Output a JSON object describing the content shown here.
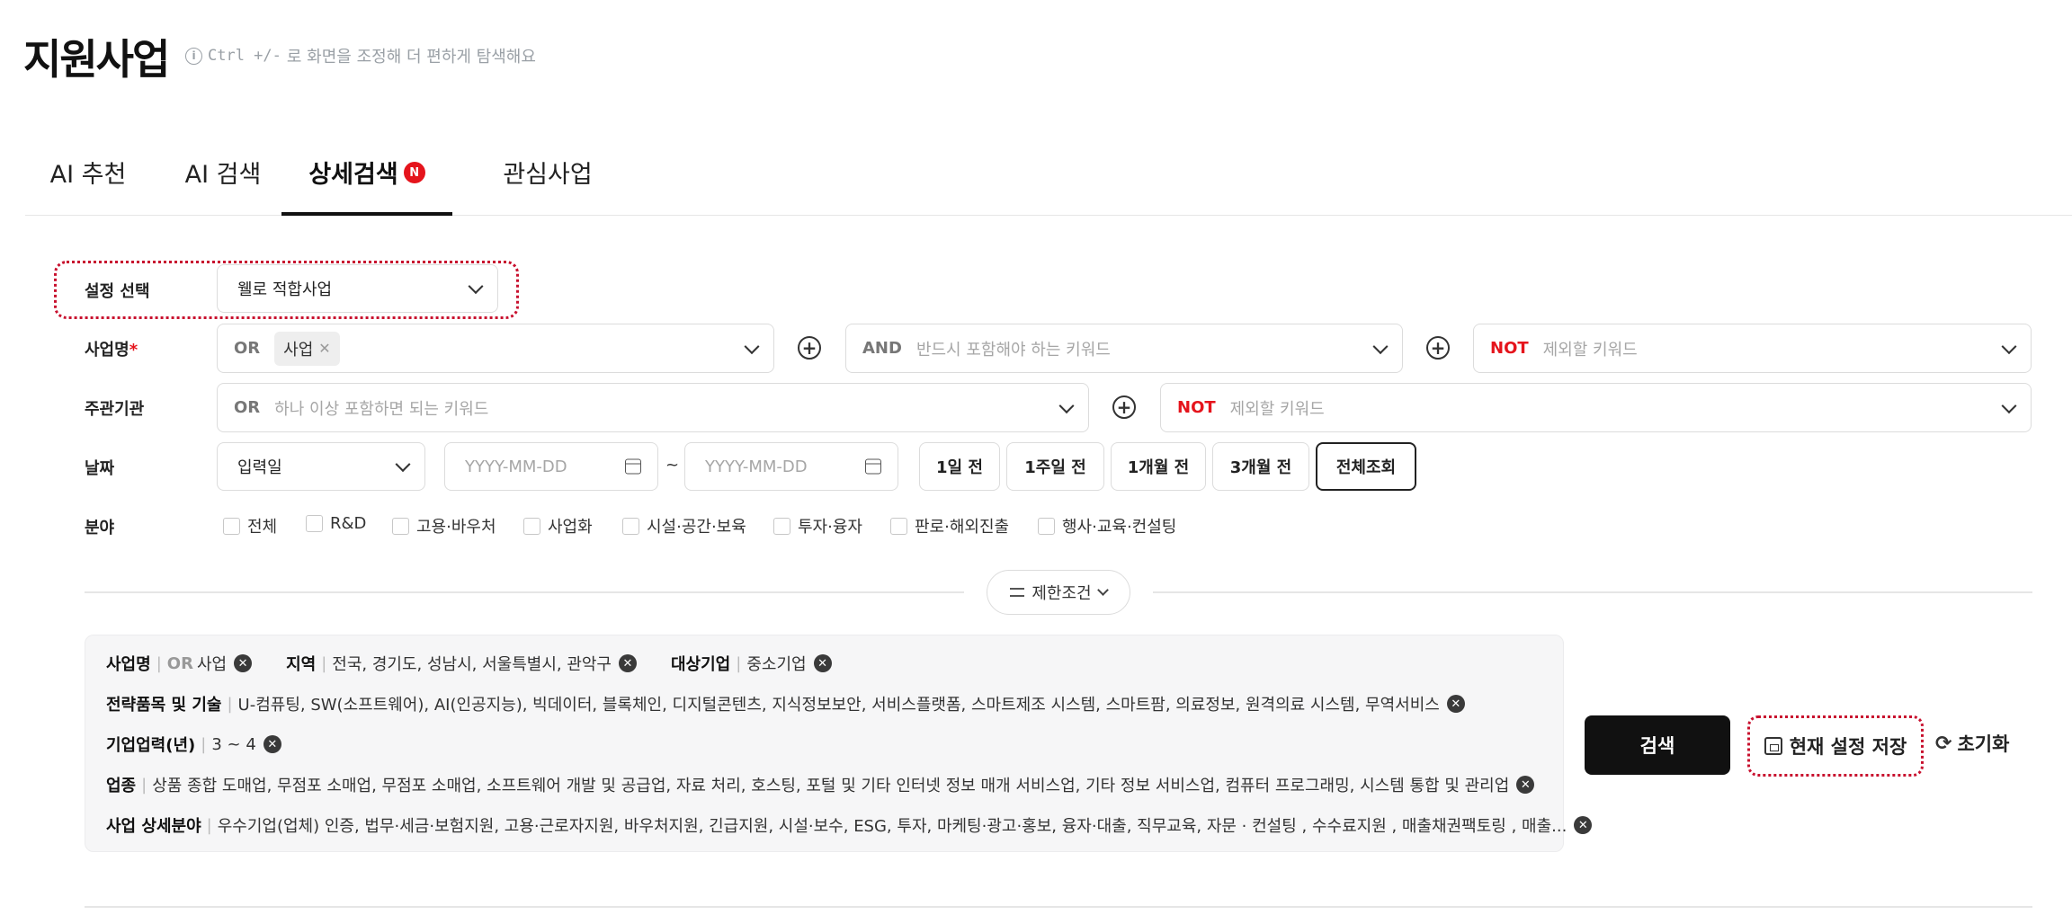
{
  "page": {
    "title": "지원사업",
    "hint_prefix": "Ctrl +/-",
    "hint_text": "로 화면을 조정해 더 편하게 탐색해요"
  },
  "tabs": [
    {
      "label": "AI 추천"
    },
    {
      "label": "AI 검색"
    },
    {
      "label": "상세검색",
      "badge": "N",
      "active": true
    },
    {
      "label": "관심사업"
    }
  ],
  "form": {
    "setting": {
      "label": "설정 선택",
      "value": "웰로 적합사업"
    },
    "business_name": {
      "label": "사업명",
      "required_mark": "*",
      "or_op": "OR",
      "chip": "사업",
      "and_op": "AND",
      "and_placeholder": "반드시 포함해야 하는 키워드",
      "not_op": "NOT",
      "not_placeholder": "제외할 키워드"
    },
    "organizer": {
      "label": "주관기관",
      "or_op": "OR",
      "or_placeholder": "하나 이상 포함하면 되는 키워드",
      "not_op": "NOT",
      "not_placeholder": "제외할 키워드"
    },
    "date": {
      "label": "날짜",
      "type_value": "입력일",
      "start_placeholder": "YYYY-MM-DD",
      "tilde": "~",
      "end_placeholder": "YYYY-MM-DD",
      "presets": [
        "1일 전",
        "1주일 전",
        "1개월 전",
        "3개월 전",
        "전체조회"
      ],
      "selected_preset": "전체조회"
    },
    "field": {
      "label": "분야",
      "options": [
        "전체",
        "R&D",
        "고용·바우처",
        "사업화",
        "시설·공간·보육",
        "투자·융자",
        "판로·해외진출",
        "행사·교육·컨설팅"
      ]
    },
    "limit_button": "제한조건"
  },
  "summary": {
    "row1": {
      "name_label": "사업명",
      "name_op": "OR",
      "name_value": "사업",
      "region_label": "지역",
      "region_value": "전국, 경기도, 성남시, 서울특별시, 관악구",
      "target_label": "대상기업",
      "target_value": "중소기업"
    },
    "row2": {
      "label": "전략품목 및 기술",
      "value": "U-컴퓨팅, SW(소프트웨어), AI(인공지능), 빅데이터, 블록체인, 디지털콘텐츠, 지식정보보안, 서비스플랫폼, 스마트제조 시스템, 스마트팜, 의료정보, 원격의료 시스템, 무역서비스"
    },
    "row3": {
      "label": "기업업력(년)",
      "value": "3 ~ 4"
    },
    "row4": {
      "label": "업종",
      "value": "상품 종합 도매업, 무점포 소매업, 무점포 소매업, 소프트웨어 개발 및 공급업, 자료 처리, 호스팅, 포털 및 기타 인터넷 정보 매개 서비스업, 기타 정보 서비스업, 컴퓨터 프로그래밍, 시스템 통합 및 관리업"
    },
    "row5": {
      "label": "사업 상세분야",
      "value": "우수기업(업체) 인증, 법무·세금·보험지원, 고용·근로자지원, 바우처지원, 긴급지원, 시설·보수, ESG, 투자, 마케팅·광고·홍보, 융자·대출, 직무교육, 자문 · 컨설팅 , 수수료지원 , 매출채권팩토링 , 매출..."
    }
  },
  "actions": {
    "search": "검색",
    "save": "현재 설정 저장",
    "reset": "초기화"
  }
}
